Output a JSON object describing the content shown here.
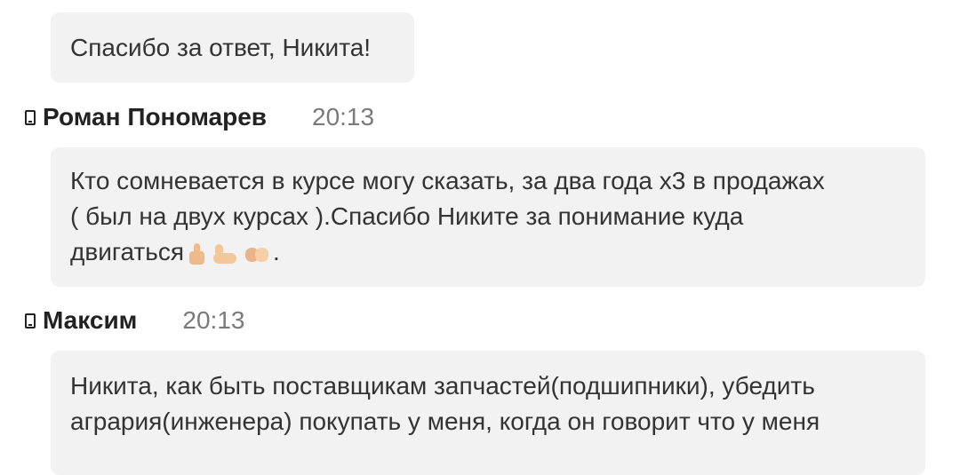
{
  "messages": [
    {
      "text": "Спасибо за ответ, Никита!"
    },
    {
      "author": "Роман Пономарев",
      "time": "20:13",
      "lines": [
        "Кто сомневается в курсе могу сказать, за два года х3 в продажах",
        "( был на двух курсах ).Спасибо Никите за понимание куда",
        "двигаться"
      ],
      "trailing": ".",
      "emojis": [
        "thumbs-up-icon",
        "flexed-biceps-icon",
        "handshake-icon"
      ]
    },
    {
      "author": "Максим",
      "time": "20:13",
      "lines": [
        "Никита, как быть поставщикам запчастей(подшипники), убедить",
        "агрария(инженера) покупать у меня, когда он говорит что у меня"
      ]
    }
  ],
  "icons": {
    "device": "phone-icon"
  },
  "colors": {
    "bubble_bg": "#f2f2f2",
    "text": "#333333",
    "author": "#222222",
    "time": "#7a7a7a"
  }
}
